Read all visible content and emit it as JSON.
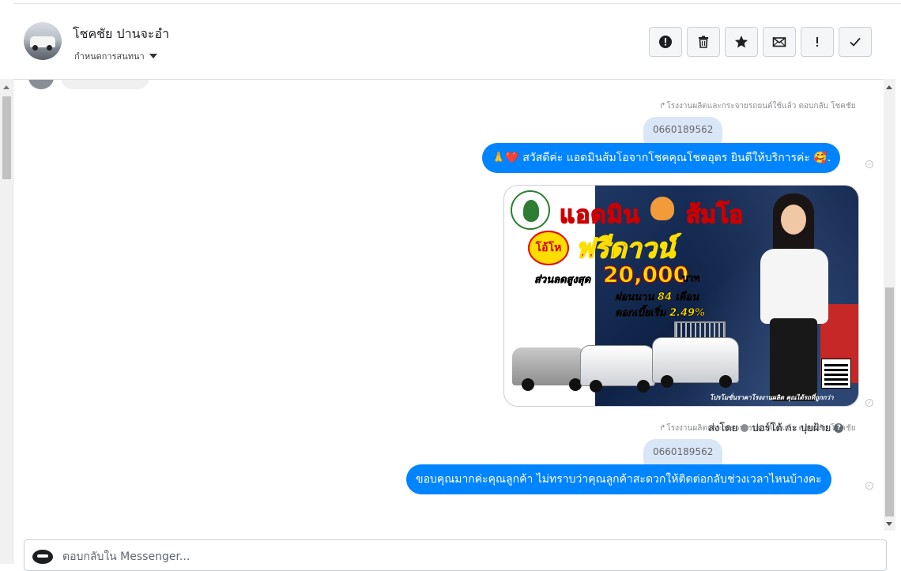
{
  "header": {
    "contact_name": "โชคชัย ปานจะอำ",
    "assign_label": "กำหนดการสนทนา",
    "toolbar": [
      {
        "name": "spam-button",
        "icon": "alert-circle-icon"
      },
      {
        "name": "delete-button",
        "icon": "trash-icon"
      },
      {
        "name": "star-button",
        "icon": "star-icon"
      },
      {
        "name": "mark-unread-button",
        "icon": "envelope-icon"
      },
      {
        "name": "follow-up-button",
        "icon": "exclamation-icon"
      },
      {
        "name": "done-button",
        "icon": "check-icon"
      }
    ]
  },
  "thread": {
    "messages": [
      {
        "reply_meta": "โรงงานผลิตและกระจายรถยนต์ใช้แล้ว ตอบกลับ โชคชัย",
        "quote": "0660189562",
        "text": "🙏❤️ สวัสดีค่ะ แอดมินส้มโอจากโชคคุณโชคอุดร ยินดีให้บริการค่ะ 🥰."
      },
      {
        "reply_meta": "โรงงานผลิตและกระจายรถยนต์ใช้แล้ว ตอบกลับ โชคชัย",
        "quote": "0660189562",
        "text": "ขอบคุณมากค่ะคุณลูกค้า ไม่ทราบว่าคุณลูกค้าสะดวกให้ติดต่อกลับช่วงเวลาไหนบ้างคะ"
      }
    ],
    "promo_image": {
      "line1a": "แอดมิน",
      "line1b": "ส้มโอ",
      "badge": "โอ้โห",
      "headline": "ฟรีดาวน์",
      "discount_label": "ส่วนลดสูงสุด",
      "discount_value": "20,000",
      "discount_unit": "บาท",
      "installment": "ผ่อนนาน 84 เดือน",
      "interest": "ดอกเบี้ยเริ่ม 2.49%",
      "footer": "โปรโมชั่นราคาโรงงานผลิต คุณได้รถที่ถูกกว่า"
    },
    "sent_by": {
      "prefix": "ส่งโดย",
      "name": "ปอร์โต้ กะ ปุยฝ้าย"
    }
  },
  "composer": {
    "placeholder": "ตอบกลับใน Messenger..."
  }
}
